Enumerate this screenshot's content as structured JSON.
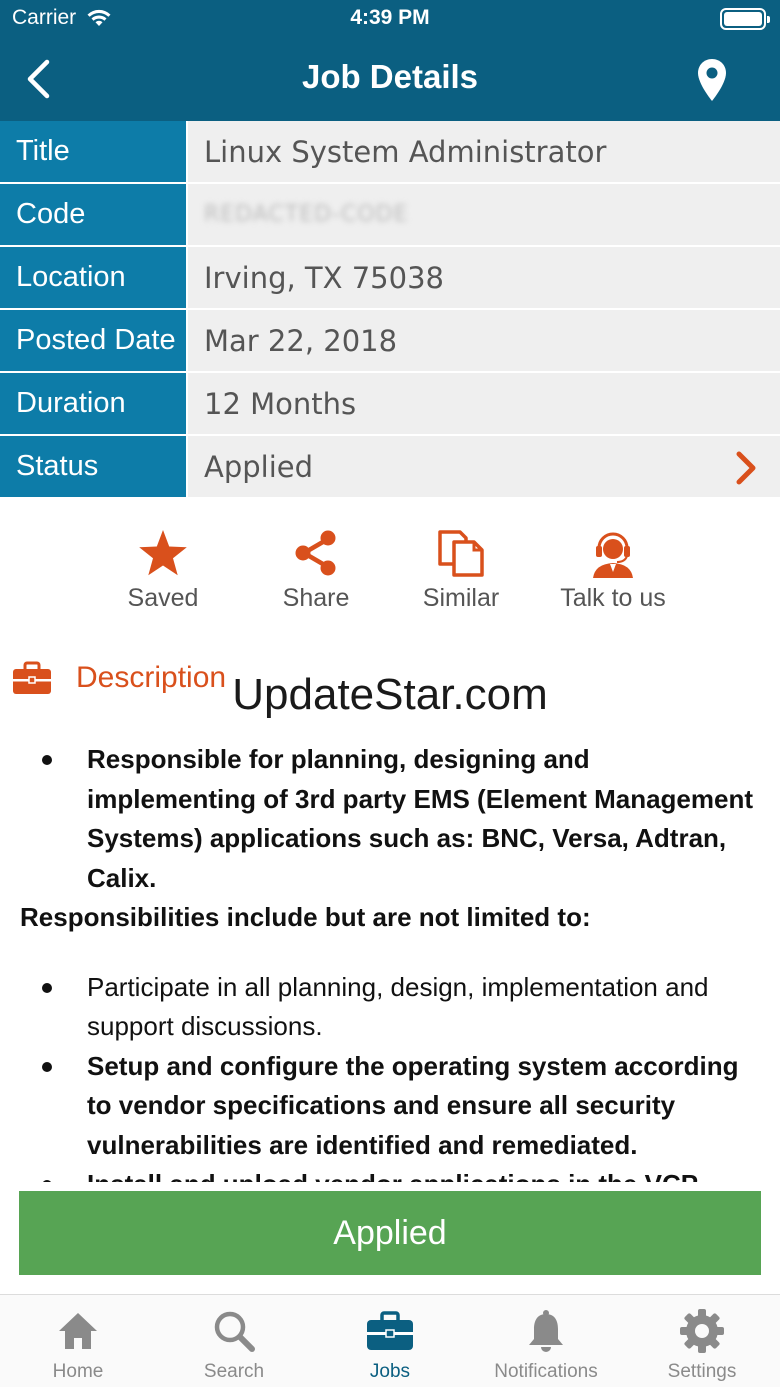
{
  "status_bar": {
    "carrier": "Carrier",
    "time": "4:39 PM"
  },
  "nav": {
    "title": "Job Details"
  },
  "details": [
    {
      "label": "Title",
      "value": "Linux System Administrator"
    },
    {
      "label": "Code",
      "value": "REDACTED-CODE"
    },
    {
      "label": "Location",
      "value": "Irving, TX 75038"
    },
    {
      "label": "Posted Date",
      "value": "Mar 22, 2018"
    },
    {
      "label": "Duration",
      "value": "12 Months"
    },
    {
      "label": "Status",
      "value": "Applied"
    }
  ],
  "actions": [
    {
      "label": "Saved",
      "icon": "star-icon"
    },
    {
      "label": "Share",
      "icon": "share-icon"
    },
    {
      "label": "Similar",
      "icon": "copy-icon"
    },
    {
      "label": "Talk to us",
      "icon": "support-agent-icon"
    }
  ],
  "description": {
    "heading": "Description",
    "watermark": "UpdateStar.com",
    "items": [
      "Responsible for planning, designing and implementing of 3rd party EMS (Element Management Systems) applications such as: BNC, Versa, Adtran, Calix.",
      "Responsibilities include but are not limited to:",
      "Participate in all planning, design, implementation and support discussions.",
      "Setup and configure the operating system according to vendor specifications and ensure all security vulnerabilities are identified and remediated.",
      "Install and upload vendor applications in the VCP"
    ]
  },
  "applied_button": "Applied",
  "tabs": [
    {
      "label": "Home",
      "icon": "home-icon"
    },
    {
      "label": "Search",
      "icon": "search-icon"
    },
    {
      "label": "Jobs",
      "icon": "briefcase-icon",
      "active": true
    },
    {
      "label": "Notifications",
      "icon": "bell-icon"
    },
    {
      "label": "Settings",
      "icon": "gear-icon"
    }
  ],
  "colors": {
    "nav_bg": "#0b5f81",
    "label_bg": "#0d7ca8",
    "accent": "#d9501c",
    "applied_green": "#57a454",
    "tab_active": "#0b5f81"
  }
}
